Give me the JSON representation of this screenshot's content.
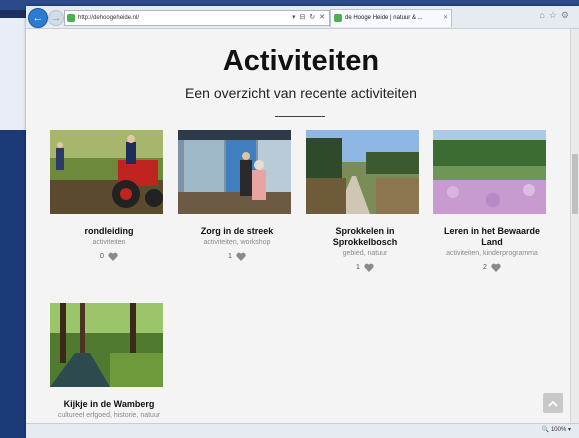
{
  "browser": {
    "url": "http://dehoogeheide.nl/",
    "tab_title": "de Hooge Heide | natuur & ...",
    "zoom": "100%"
  },
  "page": {
    "title": "Activiteiten",
    "subtitle": "Een overzicht van recente activiteiten"
  },
  "cards": [
    {
      "name": "rondleiding",
      "tags": "activiteiten",
      "likes": "0"
    },
    {
      "name": "Zorg in de streek",
      "tags": "activiteiten, workshop",
      "likes": "1"
    },
    {
      "name": "Sprokkelen in Sprokkelbosch",
      "tags": "gebied, natuur",
      "likes": "1"
    },
    {
      "name": "Leren in het Bewaarde Land",
      "tags": "activiteiten, kinderprogramma",
      "likes": "2"
    },
    {
      "name": "Kijkje in de Wamberg",
      "tags": "cultureel erfgoed, historie, natuur",
      "likes": ""
    }
  ],
  "colors": {
    "accent": "#2a7bd1",
    "heart": "#8a8a8a"
  }
}
